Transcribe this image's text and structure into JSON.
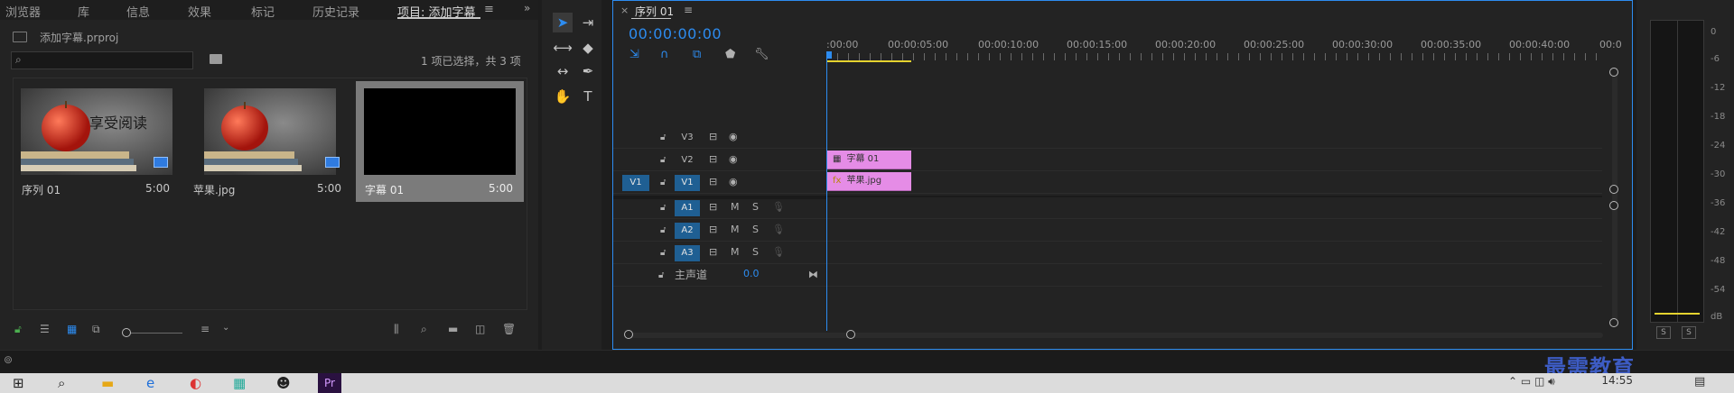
{
  "project_panel": {
    "tabs": [
      "浏览器",
      "库",
      "信息",
      "效果",
      "标记",
      "历史记录"
    ],
    "active_tab": "项目: 添加字幕",
    "menu_glyph": "≡",
    "file_name": "添加字幕.prproj",
    "selection_info": "1 项已选择，共 3 项",
    "items": [
      {
        "label": "序列 01",
        "duration": "5:00"
      },
      {
        "label": "苹果.jpg",
        "duration": "5:00"
      },
      {
        "label": "字幕 01",
        "duration": "5:00"
      }
    ],
    "apple_caption": "享受阅读"
  },
  "timeline": {
    "sequence_tab": "序列 01",
    "close_glyph": "×",
    "menu_glyph": "≡",
    "timecode": "00:00:00:00",
    "ruler": [
      ":00:00",
      "00:00:05:00",
      "00:00:10:00",
      "00:00:15:00",
      "00:00:20:00",
      "00:00:25:00",
      "00:00:30:00",
      "00:00:35:00",
      "00:00:40:00",
      "00:0"
    ],
    "video_tracks": [
      {
        "name": "V3",
        "src": ""
      },
      {
        "name": "V2",
        "src": ""
      },
      {
        "name": "V1",
        "src": "V1"
      }
    ],
    "audio_tracks": [
      {
        "name": "A1",
        "m": "M",
        "s": "S"
      },
      {
        "name": "A2",
        "m": "M",
        "s": "S"
      },
      {
        "name": "A3",
        "m": "M",
        "s": "S"
      }
    ],
    "clips": [
      {
        "track": "V2",
        "name": "字幕 01"
      },
      {
        "track": "V1",
        "name": "苹果.jpg",
        "badge": "fx"
      }
    ],
    "master": {
      "label": "主声道",
      "value": "0.0"
    }
  },
  "meters": {
    "scale": [
      "0",
      "-6",
      "-12",
      "-18",
      "-24",
      "-30",
      "-36",
      "-42",
      "-48",
      "-54",
      "dB"
    ],
    "solo": [
      "S",
      "S"
    ]
  },
  "taskbar": {
    "clock": "14:55",
    "watermark": "最需教育"
  }
}
